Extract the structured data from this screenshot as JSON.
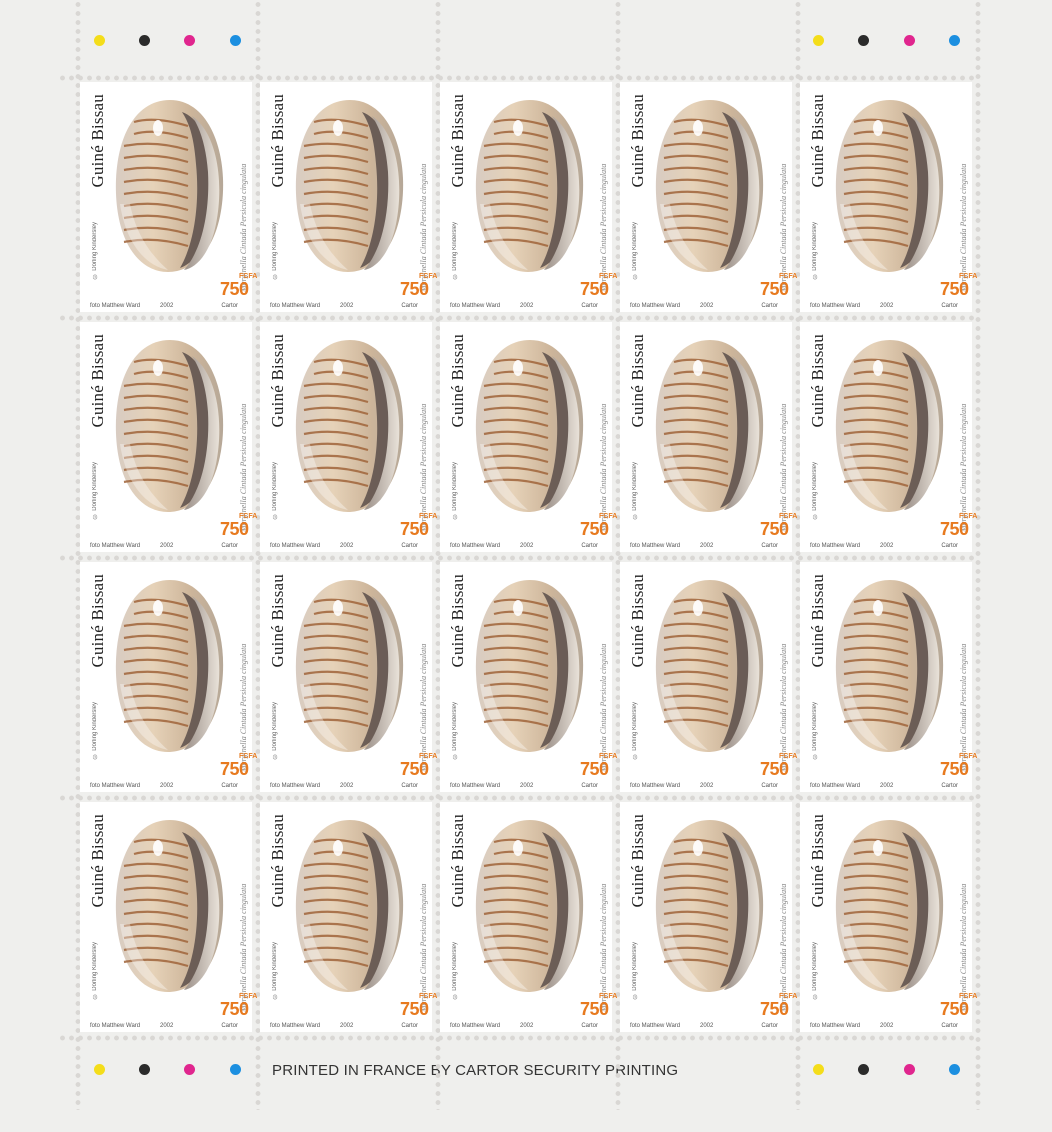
{
  "sheet": {
    "imprint": "PRINTED IN FRANCE BY CARTOR SECURITY PRINTING",
    "color_dots": [
      "#f4dd1a",
      "#2b2b2b",
      "#e0268e",
      "#1c8fe0"
    ]
  },
  "stamp": {
    "country": "Guiné Bissau",
    "species": "Marginella Cintada Persicula cingulata",
    "copyright": "© Dorling Kindersley",
    "photo_credit": "foto Matthew Ward",
    "year": "2002",
    "printer": "Cartor",
    "value": "750",
    "currency": "FCFA"
  },
  "layout_rows": 4,
  "layout_cols": 5
}
